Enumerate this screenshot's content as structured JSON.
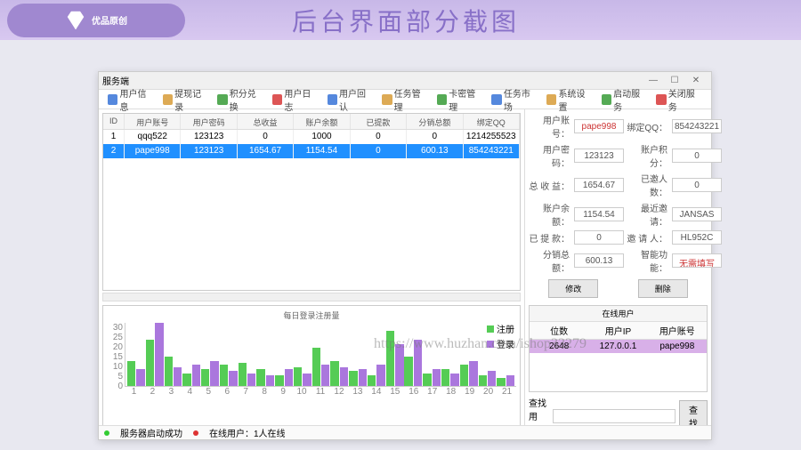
{
  "banner": {
    "logo_text": "优品原创",
    "title": "后台界面部分截图"
  },
  "window": {
    "title": "服务端"
  },
  "toolbar": {
    "items": [
      "用户信息",
      "提现记录",
      "积分兑换",
      "用户日志",
      "用户回认",
      "任务管理",
      "卡密管理",
      "任务市场",
      "系统设置"
    ],
    "right": [
      "启动服务",
      "关闭服务"
    ]
  },
  "grid": {
    "headers": [
      "ID",
      "用户账号",
      "用户密码",
      "总收益",
      "账户余额",
      "已提款",
      "分销总额",
      "绑定QQ"
    ],
    "rows": [
      {
        "id": "1",
        "user": "qqq522",
        "pwd": "123123",
        "a": "0",
        "b": "1000",
        "c": "0",
        "d": "0",
        "e": "1214255523"
      },
      {
        "id": "2",
        "user": "pape998",
        "pwd": "123123",
        "a": "1654.67",
        "b": "1154.54",
        "c": "0",
        "d": "600.13",
        "e": "854243221"
      }
    ]
  },
  "form": {
    "r1a": "用户账号：",
    "v1a": "pape998",
    "r1b": "绑定QQ：",
    "v1b": "854243221",
    "r2a": "用户密码：",
    "v2a": "123123",
    "r2b": "账户积分：",
    "v2b": "0",
    "r3a": "总 收 益：",
    "v3a": "1654.67",
    "r3b": "已邀人数：",
    "v3b": "0",
    "r4a": "账户余额：",
    "v4a": "1154.54",
    "r4b": "最近邀请：",
    "v4b": "JANSAS",
    "r5a": "已 提 款：",
    "v5a": "0",
    "r5b": "邀 请 人：",
    "v5b": "HL952C",
    "r6a": "分销总额：",
    "v6a": "600.13",
    "r6b": "智能功能：",
    "v6b": "无需填写",
    "btn_edit": "修改",
    "btn_del": "删除"
  },
  "online": {
    "title": "在线用户",
    "headers": [
      "位数",
      "用户IP",
      "用户账号"
    ],
    "row": {
      "a": "2648",
      "b": "127.0.0.1",
      "c": "pape998"
    }
  },
  "search": {
    "label": "查找用户：",
    "btn": "查找"
  },
  "status": {
    "s1": "服务器启动成功",
    "s2": "在线用户：1人在线"
  },
  "chart_data": {
    "type": "bar",
    "title": "每日登录注册量",
    "ylim": [
      0,
      30
    ],
    "yticks": [
      30,
      25,
      20,
      15,
      10,
      5,
      0
    ],
    "categories": [
      "1",
      "2",
      "3",
      "4",
      "5",
      "6",
      "7",
      "8",
      "9",
      "10",
      "11",
      "12",
      "13",
      "14",
      "15",
      "16",
      "17",
      "18",
      "19",
      "20",
      "21"
    ],
    "series": [
      {
        "name": "注册",
        "color": "g",
        "values": [
          12,
          22,
          14,
          6,
          8,
          10,
          11,
          8,
          5,
          9,
          18,
          12,
          7,
          5,
          26,
          14,
          6,
          8,
          10,
          5,
          4
        ]
      },
      {
        "name": "登录",
        "color": "p",
        "values": [
          8,
          30,
          9,
          10,
          12,
          7,
          6,
          5,
          8,
          6,
          10,
          9,
          8,
          10,
          20,
          22,
          8,
          6,
          12,
          7,
          5
        ]
      }
    ]
  },
  "watermark": "https://www.huzhan.com/ishop33279"
}
